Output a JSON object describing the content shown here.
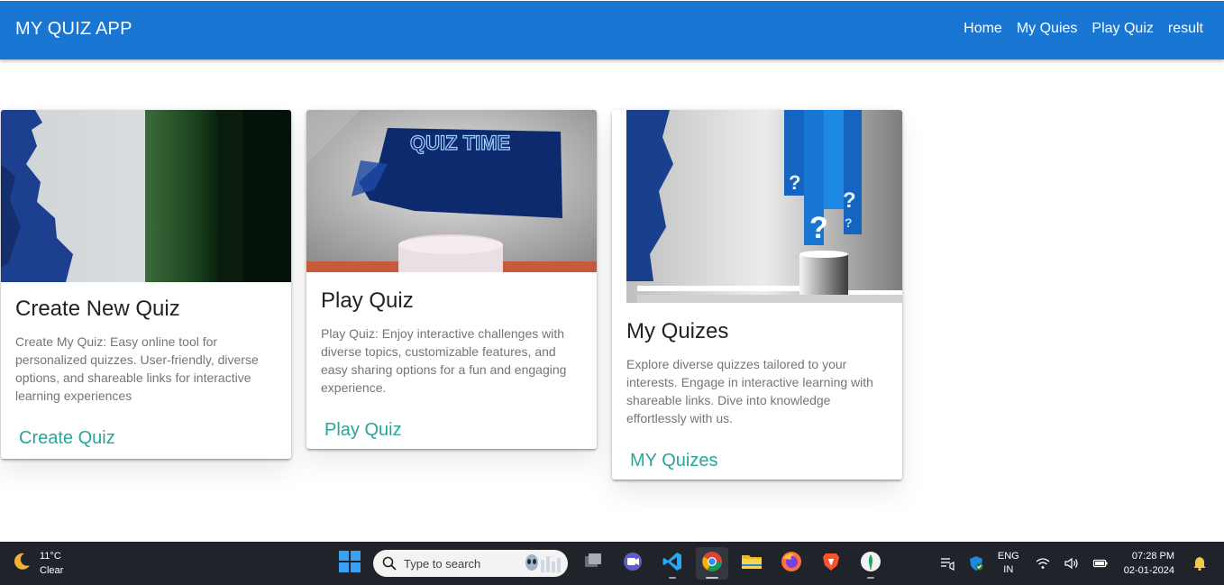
{
  "app": {
    "brand": "MY QUIZ APP",
    "nav": [
      "Home",
      "My Quies",
      "Play Quiz",
      "result"
    ]
  },
  "cards": [
    {
      "title": "Create New Quiz",
      "text": "Create My Quiz: Easy online tool for personalized quizzes. User-friendly, diverse options, and shareable links for interactive learning experiences",
      "link": "Create Quiz"
    },
    {
      "title": "Play Quiz",
      "text": "Play Quiz: Enjoy interactive challenges with diverse topics, customizable features, and easy sharing options for a fun and engaging experience.",
      "link": "Play Quiz",
      "image_text": "QUIZ TIME"
    },
    {
      "title": "My Quizes",
      "text": "Explore diverse quizzes tailored to your interests. Engage in interactive learning with shareable links. Dive into knowledge effortlessly with us.",
      "link": "MY Quizes"
    }
  ],
  "taskbar": {
    "temperature": "11°C",
    "condition": "Clear",
    "search_placeholder": "Type to search",
    "apps": [
      "task-view-icon",
      "chat-icon",
      "vscode-icon",
      "chrome-icon",
      "file-explorer-icon",
      "firefox-icon",
      "brave-icon",
      "mongodb-compass-icon"
    ],
    "lang_line1": "ENG",
    "lang_line2": "IN",
    "time": "07:28 PM",
    "date": "02-01-2024"
  },
  "colors": {
    "navbar": "#1976d2",
    "link": "#26a69a",
    "taskbar": "#20242a"
  }
}
